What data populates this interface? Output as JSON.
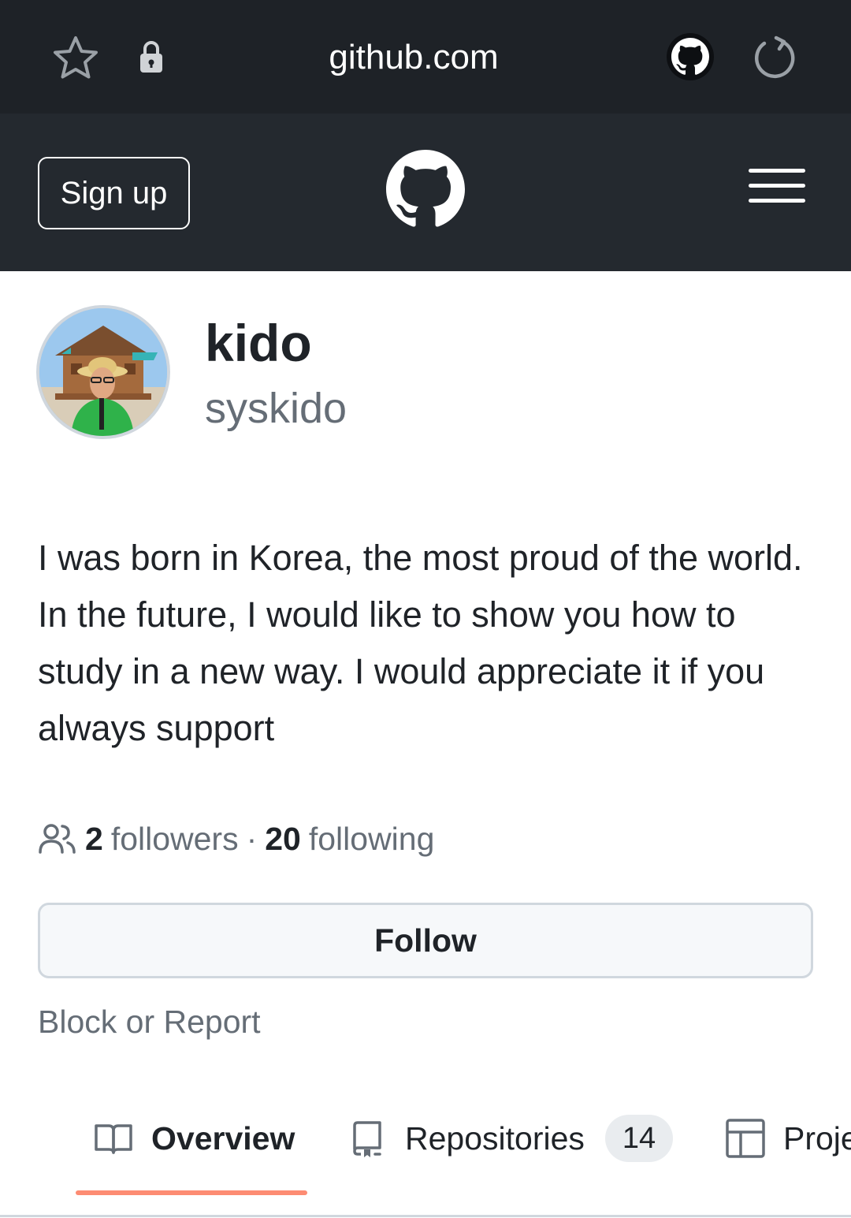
{
  "browser": {
    "url": "github.com",
    "icons": [
      "star-icon",
      "lock-icon",
      "github-icon",
      "reload-icon"
    ]
  },
  "header": {
    "signup_label": "Sign up",
    "logo": "github-mark-icon",
    "menu": "hamburger-menu-icon"
  },
  "profile": {
    "display_name": "kido",
    "username": "syskido",
    "bio": "I was born in Korea, the most proud of the world. In the future, I would like to show you how to study in a new way. I would appreciate it if you always support",
    "followers_count": "2",
    "followers_label": "followers",
    "separator": "·",
    "following_count": "20",
    "following_label": "following",
    "follow_label": "Follow",
    "block_label": "Block or Report"
  },
  "tabs": {
    "overview": "Overview",
    "repositories": "Repositories",
    "repositories_count": "14",
    "projects": "Proje"
  },
  "colors": {
    "browser_bg": "#1e2227",
    "header_bg": "#24292f",
    "tab_underline": "#fd8c73",
    "muted_text": "#656d76"
  }
}
